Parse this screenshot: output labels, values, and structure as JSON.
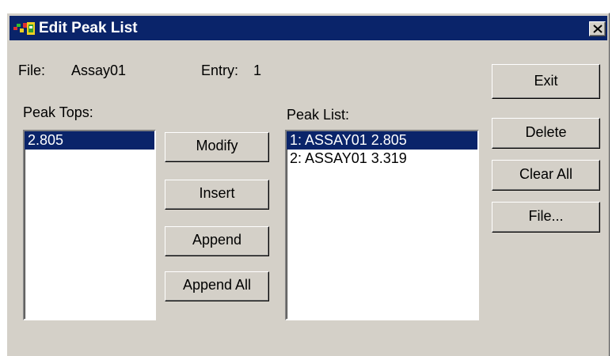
{
  "window": {
    "title": "Edit Peak List",
    "close_icon": "close-x-icon",
    "app_icon": "multicolor-app-icon",
    "title_bar_color": "#0a246a",
    "face_color": "#d4d0c8"
  },
  "info": {
    "file_label": "File:",
    "file_value": "Assay01",
    "entry_label": "Entry:",
    "entry_value": "1"
  },
  "peak_tops": {
    "label": "Peak Tops:",
    "items": [
      "2.805"
    ],
    "selected_index": 0
  },
  "peak_list": {
    "label": "Peak List:",
    "items": [
      "1: ASSAY01 2.805",
      "2: ASSAY01 3.319"
    ],
    "selected_index": 0
  },
  "middle_buttons": {
    "modify": "Modify",
    "insert": "Insert",
    "append": "Append",
    "append_all": "Append All"
  },
  "right_buttons": {
    "exit": "Exit",
    "delete": "Delete",
    "clear_all": "Clear All",
    "file": "File..."
  }
}
